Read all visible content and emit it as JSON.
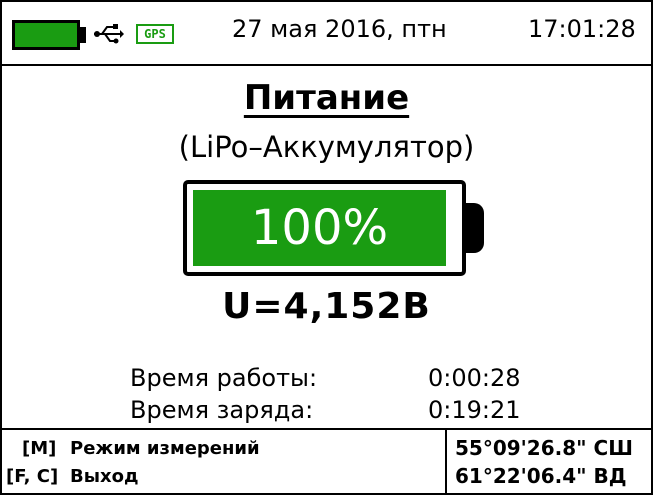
{
  "status_bar": {
    "battery_level": 1.0,
    "gps_label": "GPS",
    "date": "27 мая 2016, птн",
    "time": "17:01:28",
    "icons": [
      "battery-icon",
      "usb-icon",
      "gps-icon"
    ]
  },
  "main": {
    "title": "Питание",
    "subtitle": "(LiPo–Аккумулятор)",
    "battery_percent": 100,
    "battery_percent_text": "100%",
    "voltage_text": "U=4,152В"
  },
  "info": {
    "runtime_label": "Время работы:",
    "runtime_value": "0:00:28",
    "charge_label": "Время заряда:",
    "charge_value": "0:19:21"
  },
  "bottom_bar": {
    "key_mode": "[M]",
    "key_mode_action": "Режим измерений",
    "key_exit": "[F, C]",
    "key_exit_action": "Выход",
    "latitude": "55°09'26.8\" СШ",
    "longitude": "61°22'06.4\" ВД"
  },
  "colors": {
    "accent_green": "#1a9c12",
    "background": "#ffffff",
    "text": "#000000"
  }
}
